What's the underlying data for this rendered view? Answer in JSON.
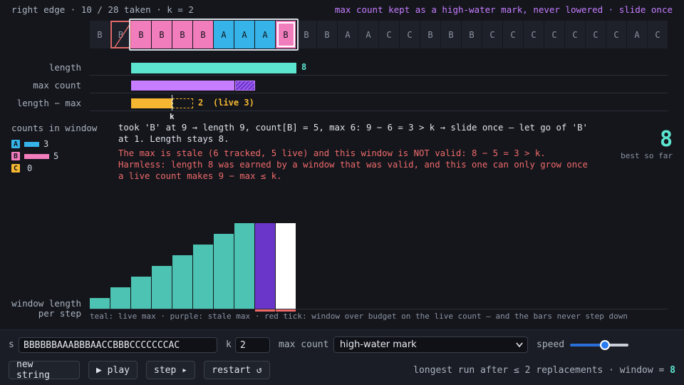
{
  "header": {
    "left": "right edge · 10 / 28 taken · k = 2",
    "right": "max count kept as a high-water mark, never lowered · slide once"
  },
  "strip": {
    "chars": [
      "B",
      "B",
      "B",
      "B",
      "B",
      "B",
      "A",
      "A",
      "A",
      "B",
      "B",
      "B",
      "A",
      "A",
      "C",
      "C",
      "B",
      "B",
      "B",
      "C",
      "C",
      "C",
      "C",
      "C",
      "C",
      "C",
      "A",
      "C"
    ],
    "window_start": 2,
    "window_end": 9,
    "removed_index": 1,
    "current_index": 9
  },
  "metrics": {
    "length_label": "length",
    "length_value": "8",
    "length_num": 8,
    "maxcount_label": "max count",
    "maxcount_tracked": 6,
    "maxcount_live": 5,
    "diff_label": "length − max",
    "diff_value": "2",
    "diff_num": 2,
    "diff_live": "(live 3)",
    "diff_live_num": 3,
    "k_label": "k",
    "k_value": 2
  },
  "counts": {
    "title": "counts in window",
    "items": [
      {
        "letter": "A",
        "count": "3",
        "num": 3,
        "color": "#36b3e8"
      },
      {
        "letter": "B",
        "count": "5",
        "num": 5,
        "color": "#f27dbd"
      },
      {
        "letter": "C",
        "count": "0",
        "num": 0,
        "color": "#f5b731"
      }
    ]
  },
  "narration": {
    "line1": "took 'B' at 9 → length 9, count[B] = 5, max 6: 9 − 6 = 3 > k → slide once — let go of 'B'",
    "line2": "at 1. Length stays 8.",
    "warn1": "The max is stale (6 tracked, 5 live) and this window is NOT valid: 8 − 5 = 3 > k.",
    "warn2": "Harmless: length 8 was earned by a window that was valid, and this one can only grow once",
    "warn3": "a live count makes 9 − max ≤ k."
  },
  "best": {
    "value": "8",
    "label": "best so far"
  },
  "history": {
    "label_line1": "window length",
    "label_line2": "per step",
    "values": [
      1,
      2,
      3,
      4,
      5,
      6,
      7,
      8,
      8,
      8
    ],
    "kinds": [
      "live",
      "live",
      "live",
      "live",
      "live",
      "live",
      "live",
      "live",
      "stale",
      "current"
    ],
    "over_budget": [
      false,
      false,
      false,
      false,
      false,
      false,
      false,
      false,
      true,
      true
    ],
    "caption": "teal: live max · purple: stale max · red tick: window over budget on the live count — and the bars never step down"
  },
  "controls": {
    "s_label": "s",
    "s_value": "BBBBBBAAABBBAACCBBBCCCCCCCAC",
    "k_label": "k",
    "k_value": "2",
    "maxcount_label": "max count",
    "maxcount_selected": "high-water mark",
    "speed_label": "speed",
    "speed_fraction": 0.6,
    "new_string": "new string",
    "play": "▶ play",
    "step": "step ▸",
    "restart": "restart ↺",
    "footer_prefix": "longest run after ≤ 2 replacements · window = ",
    "footer_window": "8"
  },
  "colors": {
    "teal": "#5ce6d0",
    "teal_bar": "#4dc4b3",
    "purple_light": "#c77dff",
    "purple_stale": "#6a35c9",
    "amber": "#f5b731",
    "red": "#f06a6a",
    "a_color": "#36b3e8",
    "b_color": "#f27dbd"
  }
}
